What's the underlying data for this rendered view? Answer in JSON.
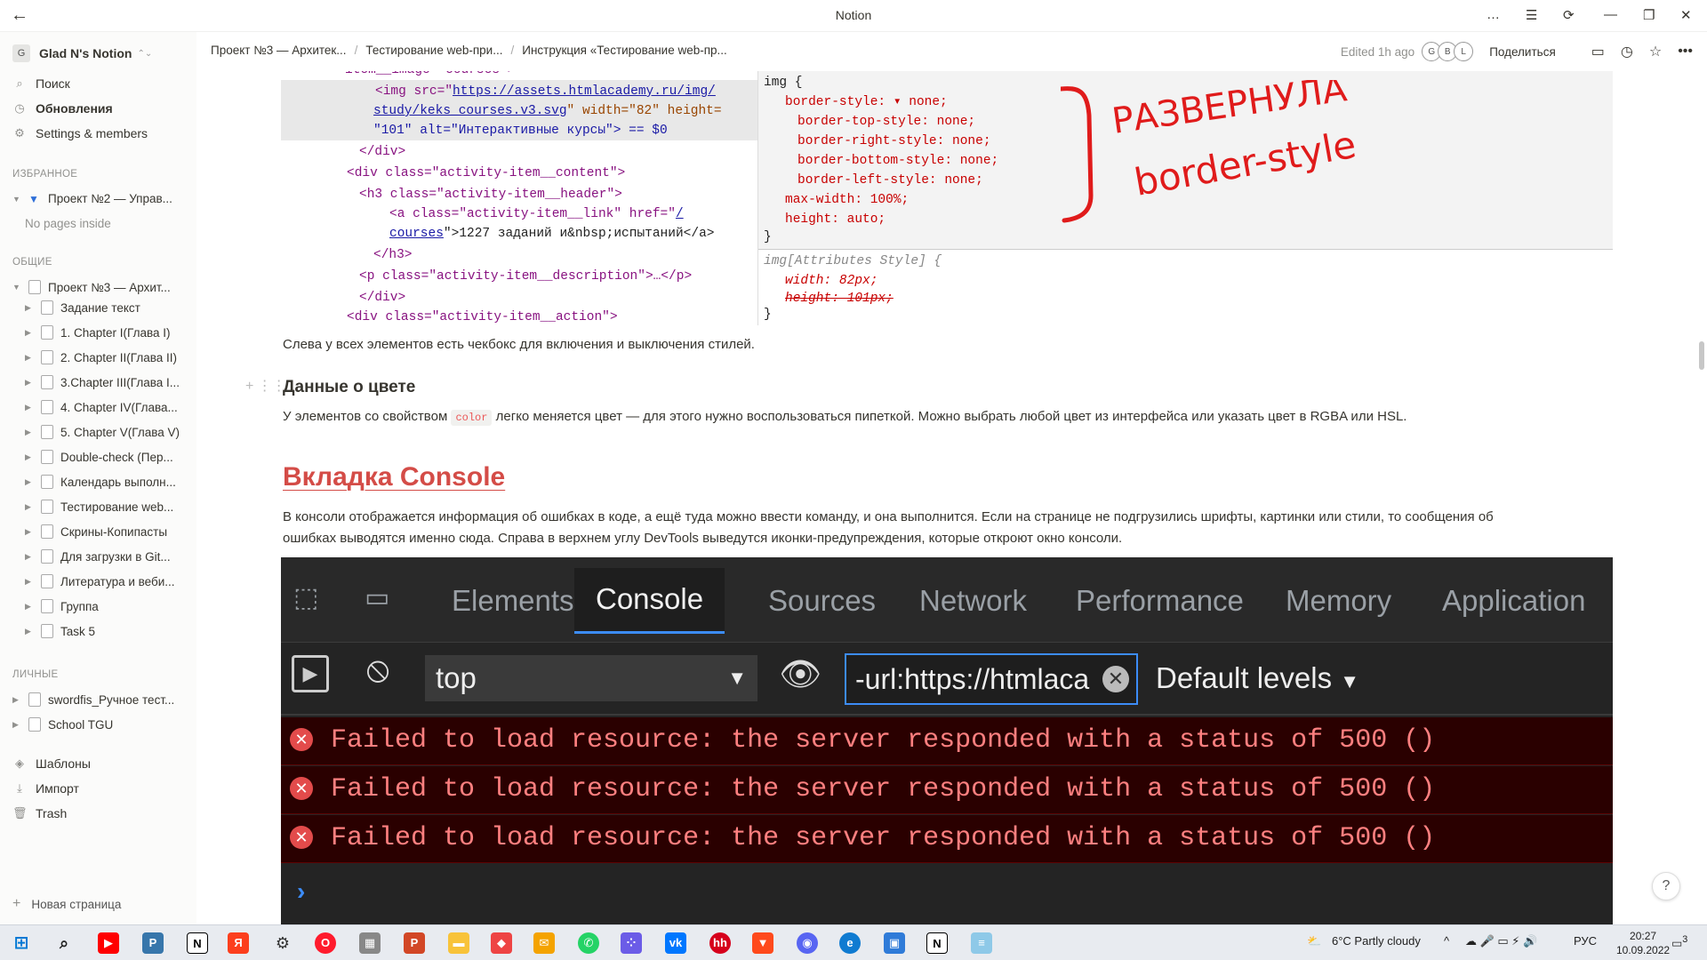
{
  "window": {
    "title": "Notion"
  },
  "sidebar": {
    "workspace_initial": "G",
    "workspace": "Glad N's Notion",
    "search": "Поиск",
    "updates": "Обновления",
    "settings": "Settings & members",
    "fav_header": "ИЗБРАННОЕ",
    "fav_item": "Проект №2 — Управ...",
    "fav_empty": "No pages inside",
    "shared_header": "ОБЩИЕ",
    "shared_root": "Проект №3 — Архит...",
    "shared_children": [
      "Задание текст",
      "1. Chapter I(Глава I)",
      "2. Chapter II(Глава II)",
      "3.Chapter III(Глава I...",
      "4. Chapter IV(Глава...",
      "5. Chapter V(Глава V)",
      "Double-check (Пер...",
      "Календарь выполн...",
      "Тестирование web...",
      "Скрины-Копипасты",
      "Для загрузки в Git...",
      "Литература и веби...",
      "Группа",
      "Task 5"
    ],
    "private_header": "ЛИЧНЫЕ",
    "private_items": [
      "swordfis_Ручное тест...",
      "School TGU"
    ],
    "templates": "Шаблоны",
    "import": "Импорт",
    "trash": "Trash",
    "new_page": "Новая страница"
  },
  "topbar": {
    "breadcrumbs": [
      "Проект №3 — Архитек...",
      "Тестирование web-при...",
      "Инструкция «Тестирование web-пр..."
    ],
    "edited": "Edited 1h ago",
    "avatars": [
      "G",
      "B",
      "L"
    ],
    "share": "Поделиться"
  },
  "screenshot1": {
    "html_lines": [
      "item__image--courses\">",
      "<img src=\"",
      "https://assets.htmlacademy.ru/img/",
      "\" width=\"82\" height=",
      "study/keks_courses.v3.svg",
      "\"101\" alt=\"Интерактивные курсы\"> == $0",
      "</div>",
      "<div class=\"activity-item__content\">",
      "<h3 class=\"activity-item__header\">",
      "<a class=\"activity-item__link\" href=\"",
      "/",
      "courses",
      "\">1227 заданий и&nbsp;испытаний</a>",
      "</h3>",
      "<p class=\"activity-item__description\">…</p>",
      "</div>",
      "<div class=\"activity-item__action\">"
    ],
    "css_lines": [
      "img {",
      "border-style: ▾ none;",
      "border-top-style: none;",
      "border-right-style: none;",
      "border-bottom-style: none;",
      "border-left-style: none;",
      "max-width: 100%;",
      "height: auto;",
      "}",
      "img[Attributes Style] {",
      "width: 82px;",
      "height: 101px;",
      "}"
    ],
    "handwritten": [
      "РАЗВЕРНУЛА",
      "border-style"
    ]
  },
  "content": {
    "para1": "Слева у всех элементов есть чекбокс для включения и выключения стилей.",
    "h3": "Данные о цвете",
    "para2_before": "У элементов со свойством",
    "para2_code": "color",
    "para2_after": "легко меняется цвет — для этого нужно воспользоваться пипеткой. Можно выбрать любой цвет из интерфейса или указать цвет в RGBA или HSL.",
    "h2": "Вкладка Console",
    "para3": "В консоли отображается информация об ошибках в коде, а ещё туда можно ввести команду, и она выполнится. Если на странице не подгрузились шрифты, картинки или стили, то сообщения об ошибках выводятся именно сюда. Справа в верхнем углу DevTools выведутся иконки-предупреждения, которые откроют окно консоли."
  },
  "devtools": {
    "tabs": [
      "Elements",
      "Console",
      "Sources",
      "Network",
      "Performance",
      "Memory",
      "Application"
    ],
    "active_tab": "Console",
    "context": "top",
    "filter": "-url:https://htmlaca",
    "levels": "Default levels",
    "errors": [
      "Failed to load resource: the server responded with a status of 500 ()",
      "Failed to load resource: the server responded with a status of 500 ()",
      "Failed to load resource: the server responded with a status of 500 ()"
    ]
  },
  "taskbar": {
    "weather": "6°C  Partly cloudy",
    "lang": "РУС",
    "time": "20:27",
    "date": "10.09.2022",
    "notifications": "3"
  },
  "colors": {
    "accent_red": "#d44c47",
    "devtools_blue": "#3c8cf7",
    "error_text": "#ff8080"
  }
}
